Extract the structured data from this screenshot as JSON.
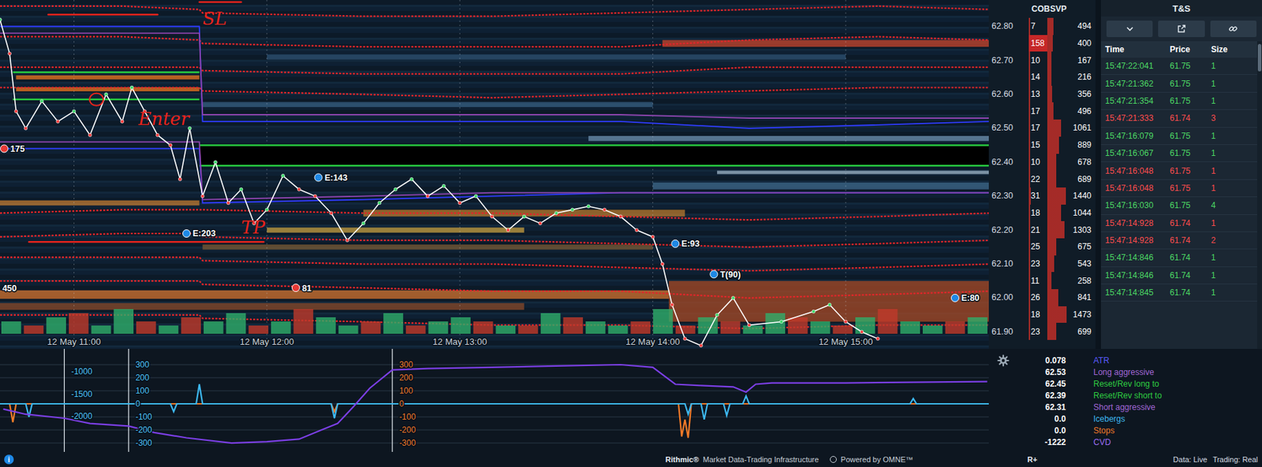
{
  "chart": {
    "x_range": [
      37,
      344.5
    ],
    "y_range": [
      61.85,
      62.878
    ],
    "time_labels": [
      {
        "label": "12 May 11:00",
        "t": 60
      },
      {
        "label": "12 May 12:00",
        "t": 120
      },
      {
        "label": "12 May 13:00",
        "t": 180
      },
      {
        "label": "12 May 14:00",
        "t": 240
      },
      {
        "label": "12 May 15:00",
        "t": 300
      }
    ],
    "heat_bands": [
      {
        "p": 62.01,
        "h": 0.025,
        "t0": 37,
        "t1": 245,
        "color": "#d4722c"
      },
      {
        "p": 61.975,
        "h": 0.02,
        "t0": 37,
        "t1": 200,
        "color": "#8a4a2a"
      },
      {
        "p": 62.25,
        "h": 0.02,
        "t0": 150,
        "t1": 250,
        "color": "#b87a2e"
      },
      {
        "p": 62.2,
        "h": 0.015,
        "t0": 120,
        "t1": 200,
        "color": "#caa040"
      },
      {
        "p": 62.75,
        "h": 0.02,
        "t0": 243,
        "t1": 344.5,
        "color": "#c9452c"
      },
      {
        "p": 61.99,
        "h": 0.12,
        "t0": 245,
        "t1": 344.5,
        "color": "#a84a26"
      },
      {
        "p": 62.47,
        "h": 0.015,
        "t0": 220,
        "t1": 344.5,
        "color": "#6d8fae"
      },
      {
        "p": 62.37,
        "h": 0.01,
        "t0": 260,
        "t1": 344.5,
        "color": "#9fb6c8"
      },
      {
        "p": 62.57,
        "h": 0.015,
        "t0": 100,
        "t1": 240,
        "color": "#355d80"
      },
      {
        "p": 62.33,
        "h": 0.02,
        "t0": 240,
        "t1": 344.5,
        "color": "#3f6a8c"
      },
      {
        "p": 62.15,
        "h": 0.015,
        "t0": 100,
        "t1": 240,
        "color": "#7a5a34"
      },
      {
        "p": 62.71,
        "h": 0.015,
        "t0": 120,
        "t1": 300,
        "color": "#2e5374"
      },
      {
        "p": 62.28,
        "h": 0.015,
        "t0": 37,
        "t1": 99,
        "color": "#c07a30"
      },
      {
        "p": 62.65,
        "h": 0.012,
        "t0": 42,
        "t1": 99,
        "color": "#f07820"
      },
      {
        "p": 62.615,
        "h": 0.012,
        "t0": 42,
        "t1": 99,
        "color": "#f07820"
      }
    ],
    "zones": [
      {
        "kind": "box",
        "t0": 41,
        "t1": 99,
        "top": 62.665,
        "bottom": 62.585,
        "color": "#27c93f"
      },
      {
        "kind": "fill",
        "t0": 99,
        "t1": 344.5,
        "top": 62.45,
        "bottom": 62.39,
        "color": "#27c93f"
      }
    ],
    "lines_t": [
      37,
      75,
      99,
      100,
      150,
      190,
      230,
      270,
      310,
      345
    ],
    "lines": [
      {
        "color": "#e3262a",
        "dashed": true,
        "values": [
          62.86,
          62.86,
          62.85,
          62.84,
          62.83,
          62.83,
          62.84,
          62.85,
          62.86,
          62.85
        ]
      },
      {
        "color": "#e3262a",
        "dashed": true,
        "values": [
          62.77,
          62.77,
          62.76,
          62.75,
          62.74,
          62.74,
          62.74,
          62.76,
          62.77,
          62.76
        ]
      },
      {
        "color": "#e3262a",
        "dashed": true,
        "values": [
          62.68,
          62.68,
          62.68,
          62.67,
          62.66,
          62.66,
          62.66,
          62.68,
          62.68,
          62.68
        ]
      },
      {
        "color": "#e3262a",
        "dashed": true,
        "values": [
          62.62,
          62.62,
          62.62,
          62.61,
          62.6,
          62.59,
          62.6,
          62.61,
          62.62,
          62.62
        ]
      },
      {
        "color": "#2f3cff",
        "dashed": false,
        "values": [
          62.8,
          62.8,
          62.8,
          62.52,
          62.52,
          62.52,
          62.52,
          62.5,
          62.51,
          62.52
        ]
      },
      {
        "color": "#8e44ad",
        "dashed": false,
        "values": [
          62.78,
          62.78,
          62.78,
          62.54,
          62.54,
          62.54,
          62.54,
          62.53,
          62.53,
          62.53
        ]
      },
      {
        "color": "#2f3cff",
        "dashed": false,
        "values": [
          62.44,
          62.44,
          62.44,
          62.28,
          62.29,
          62.3,
          62.31,
          62.31,
          62.31,
          62.31
        ]
      },
      {
        "color": "#8e44ad",
        "dashed": false,
        "values": [
          62.46,
          62.46,
          62.46,
          62.29,
          62.3,
          62.31,
          62.31,
          62.31,
          62.31,
          62.31
        ]
      },
      {
        "color": "#e3262a",
        "dashed": true,
        "values": [
          62.25,
          62.26,
          62.26,
          62.26,
          62.25,
          62.25,
          62.24,
          62.23,
          62.24,
          62.25
        ]
      },
      {
        "color": "#e3262a",
        "dashed": true,
        "values": [
          62.18,
          62.19,
          62.19,
          62.18,
          62.17,
          62.17,
          62.16,
          62.15,
          62.16,
          62.17
        ]
      },
      {
        "color": "#e3262a",
        "dashed": true,
        "values": [
          62.12,
          62.12,
          62.12,
          62.11,
          62.1,
          62.1,
          62.09,
          62.08,
          62.09,
          62.1
        ]
      },
      {
        "color": "#e3262a",
        "dashed": true,
        "values": [
          62.05,
          62.05,
          62.05,
          62.04,
          62.03,
          62.02,
          62.02,
          62.0,
          62.01,
          62.02
        ]
      },
      {
        "color": "#e3262a",
        "dashed": true,
        "values": [
          61.95,
          61.95,
          61.95,
          61.94,
          61.93,
          61.92,
          61.92,
          61.91,
          61.92,
          61.92
        ]
      }
    ],
    "price": {
      "t": [
        37,
        40,
        42,
        45,
        50,
        55,
        60,
        65,
        70,
        75,
        78,
        82,
        86,
        90,
        93,
        96,
        100,
        104,
        108,
        112,
        116,
        120,
        125,
        130,
        135,
        140,
        145,
        150,
        155,
        160,
        165,
        170,
        175,
        180,
        185,
        190,
        195,
        200,
        205,
        210,
        215,
        220,
        225,
        230,
        235,
        240,
        243,
        246,
        250,
        255,
        260,
        265,
        270,
        280,
        290,
        295,
        300,
        305,
        310
      ],
      "p": [
        62.82,
        62.72,
        62.55,
        62.5,
        62.58,
        62.52,
        62.55,
        62.48,
        62.6,
        62.52,
        62.62,
        62.55,
        62.48,
        62.45,
        62.35,
        62.5,
        62.3,
        62.4,
        62.28,
        62.32,
        62.22,
        62.26,
        62.36,
        62.32,
        62.3,
        62.25,
        62.17,
        62.22,
        62.28,
        62.32,
        62.35,
        62.3,
        62.33,
        62.28,
        62.3,
        62.24,
        62.2,
        62.24,
        62.22,
        62.25,
        62.26,
        62.27,
        62.26,
        62.24,
        62.2,
        62.18,
        62.1,
        61.98,
        61.88,
        61.86,
        61.95,
        62.0,
        61.92,
        61.93,
        61.96,
        61.98,
        61.93,
        61.9,
        61.88
      ]
    },
    "volume": [
      3,
      -2,
      4,
      -5,
      2,
      6,
      -3,
      2,
      -4,
      3,
      5,
      -2,
      3,
      -6,
      4,
      2,
      -3,
      5,
      -2,
      3,
      4,
      -3,
      2,
      -2,
      5,
      -4,
      3,
      2,
      -3,
      6,
      -2,
      4,
      -3,
      2,
      5,
      -4,
      3,
      -2,
      4,
      -6,
      3,
      2,
      -3,
      4
    ],
    "markers": [
      {
        "kind": "stop",
        "label": "175",
        "t": 38.3,
        "p": 62.44
      },
      {
        "kind": "entry",
        "label": "E:203",
        "t": 95,
        "p": 62.19
      },
      {
        "kind": "entry",
        "label": "E:143",
        "t": 136,
        "p": 62.355
      },
      {
        "kind": "stop",
        "label": "81",
        "t": 129,
        "p": 62.03
      },
      {
        "kind": "entry",
        "label": "E:93",
        "t": 247,
        "p": 62.16
      },
      {
        "kind": "entry",
        "label": "T(90)",
        "t": 259,
        "p": 62.07
      },
      {
        "kind": "text",
        "label": "450",
        "t": 37.3,
        "p": 62.03
      },
      {
        "kind": "entry",
        "label": "E:80",
        "t": 334,
        "p": 62.0
      }
    ],
    "annotations": [
      {
        "kind": "line",
        "t0": 52,
        "t1": 86,
        "p": 62.835
      },
      {
        "kind": "line",
        "t0": 99,
        "t1": 112,
        "p": 62.872
      },
      {
        "kind": "text",
        "text": "SL",
        "t": 100,
        "p": 62.805
      },
      {
        "kind": "circle",
        "t": 67,
        "p": 62.585
      },
      {
        "kind": "text",
        "text": "Enter",
        "t": 80,
        "p": 62.51
      },
      {
        "kind": "line",
        "t0": 46,
        "t1": 119,
        "p": 62.165
      },
      {
        "kind": "text",
        "text": "TP",
        "t": 112,
        "p": 62.19
      }
    ]
  },
  "ladder": {
    "headers": {
      "cob": "COB",
      "svp": "SVP"
    },
    "rows": [
      {
        "price": "62.80",
        "cob": "7",
        "svp": "494",
        "highlight": false
      },
      {
        "price": "",
        "cob": "158",
        "svp": "400",
        "highlight": true
      },
      {
        "price": "62.70",
        "cob": "10",
        "svp": "167",
        "highlight": false
      },
      {
        "price": "",
        "cob": "14",
        "svp": "216",
        "highlight": false
      },
      {
        "price": "62.60",
        "cob": "13",
        "svp": "356",
        "highlight": false
      },
      {
        "price": "",
        "cob": "17",
        "svp": "496",
        "highlight": false
      },
      {
        "price": "62.50",
        "cob": "17",
        "svp": "1061",
        "highlight": false
      },
      {
        "price": "",
        "cob": "15",
        "svp": "889",
        "highlight": false
      },
      {
        "price": "62.40",
        "cob": "10",
        "svp": "678",
        "highlight": false
      },
      {
        "price": "",
        "cob": "22",
        "svp": "689",
        "highlight": false
      },
      {
        "price": "62.30",
        "cob": "31",
        "svp": "1440",
        "highlight": false
      },
      {
        "price": "",
        "cob": "18",
        "svp": "1044",
        "highlight": false
      },
      {
        "price": "62.20",
        "cob": "21",
        "svp": "1303",
        "highlight": false
      },
      {
        "price": "",
        "cob": "25",
        "svp": "675",
        "highlight": false
      },
      {
        "price": "62.10",
        "cob": "23",
        "svp": "543",
        "highlight": false
      },
      {
        "price": "",
        "cob": "11",
        "svp": "258",
        "highlight": false
      },
      {
        "price": "62.00",
        "cob": "26",
        "svp": "841",
        "highlight": false
      },
      {
        "price": "",
        "cob": "18",
        "svp": "1473",
        "highlight": false
      },
      {
        "price": "61.90",
        "cob": "23",
        "svp": "699",
        "highlight": false
      }
    ]
  },
  "time_sales": {
    "title": "T&S",
    "columns": [
      "Time",
      "Price",
      "Size"
    ],
    "rows": [
      {
        "time": "15:47:22:041",
        "price": "61.75",
        "size": "1",
        "color": "#4cd964"
      },
      {
        "time": "15:47:21:362",
        "price": "61.75",
        "size": "1",
        "color": "#4cd964"
      },
      {
        "time": "15:47:21:354",
        "price": "61.75",
        "size": "1",
        "color": "#4cd964"
      },
      {
        "time": "15:47:21:333",
        "price": "61.74",
        "size": "3",
        "color": "#ff4d4d"
      },
      {
        "time": "15:47:16:079",
        "price": "61.75",
        "size": "1",
        "color": "#4cd964"
      },
      {
        "time": "15:47:16:067",
        "price": "61.75",
        "size": "1",
        "color": "#4cd964"
      },
      {
        "time": "15:47:16:048",
        "price": "61.75",
        "size": "1",
        "color": "#ff4d4d"
      },
      {
        "time": "15:47:16:048",
        "price": "61.75",
        "size": "1",
        "color": "#ff4d4d"
      },
      {
        "time": "15:47:16:030",
        "price": "61.75",
        "size": "4",
        "color": "#4cd964"
      },
      {
        "time": "15:47:14:928",
        "price": "61.74",
        "size": "1",
        "color": "#ff4d4d"
      },
      {
        "time": "15:47:14:928",
        "price": "61.74",
        "size": "2",
        "color": "#ff4d4d"
      },
      {
        "time": "15:47:14:846",
        "price": "61.74",
        "size": "1",
        "color": "#4cd964"
      },
      {
        "time": "15:47:14:846",
        "price": "61.74",
        "size": "1",
        "color": "#4cd964"
      },
      {
        "time": "15:47:14:845",
        "price": "61.74",
        "size": "1",
        "color": "#4cd964"
      }
    ]
  },
  "indicator": {
    "scales": [
      {
        "t": 57,
        "color": "#4fc3f7",
        "min": -2800,
        "max": -492,
        "ticks": [
          "-1000",
          "-1500",
          "-2000"
        ]
      },
      {
        "t": 77,
        "color": "#4fc3f7",
        "min": -368,
        "max": 421,
        "ticks": [
          "300",
          "200",
          "100",
          "0",
          "-100",
          "-200",
          "-300"
        ]
      },
      {
        "t": 159,
        "color": "#f07a28",
        "min": -368,
        "max": 421,
        "ticks": [
          "300",
          "200",
          "100",
          "0",
          "-100",
          "-200",
          "-300"
        ]
      }
    ],
    "series": [
      {
        "color": "#f07a28",
        "t": [
          37,
          40,
          41,
          42,
          60,
          140,
          141,
          142,
          248,
          249,
          250,
          251,
          252,
          345
        ],
        "v": [
          0,
          0,
          -140,
          0,
          0,
          0,
          -60,
          0,
          0,
          -250,
          -120,
          -260,
          0,
          0
        ]
      },
      {
        "color": "#3db8f0",
        "t": [
          37,
          45,
          46,
          47,
          90,
          91,
          92,
          98,
          99,
          100,
          140,
          141,
          142,
          250,
          251,
          252,
          255,
          256,
          257,
          262,
          263,
          264,
          268,
          269,
          270,
          320,
          321,
          322,
          345
        ],
        "v": [
          0,
          0,
          -100,
          0,
          0,
          -60,
          0,
          0,
          150,
          0,
          0,
          -110,
          0,
          0,
          -80,
          0,
          0,
          -120,
          0,
          0,
          -90,
          0,
          0,
          60,
          0,
          0,
          40,
          0,
          0
        ]
      },
      {
        "color": "#7b3fe4",
        "t": [
          38,
          45,
          57,
          65,
          77,
          85,
          95,
          109,
          120,
          130,
          137,
          142,
          147,
          152,
          159,
          170,
          190,
          210,
          230,
          240,
          247,
          255,
          265,
          269,
          272,
          277,
          300,
          320,
          344
        ],
        "v": [
          -40,
          -80,
          -110,
          -150,
          -170,
          -220,
          -260,
          -300,
          -290,
          -270,
          -200,
          -150,
          -20,
          120,
          260,
          270,
          280,
          290,
          300,
          280,
          150,
          140,
          130,
          90,
          150,
          160,
          160,
          165,
          170
        ]
      }
    ]
  },
  "legend": [
    {
      "value": "0.078",
      "label": "ATR",
      "color": "#5a5aff"
    },
    {
      "value": "62.53",
      "label": "Long aggressive",
      "color": "#a066d6"
    },
    {
      "value": "62.45",
      "label": "Reset/Rev long to",
      "color": "#2ecc40"
    },
    {
      "value": "62.39",
      "label": "Reset/Rev short to",
      "color": "#2ecc40"
    },
    {
      "value": "62.31",
      "label": "Short aggressive",
      "color": "#a066d6"
    },
    {
      "value": "0.0",
      "label": "Icebergs",
      "color": "#3db8f0"
    },
    {
      "value": "0.0",
      "label": "Stops",
      "color": "#f07a28"
    },
    {
      "value": "-1222",
      "label": "CVD",
      "color": "#9a6cf0"
    }
  ],
  "footer": {
    "info": "i",
    "provider": "Rithmic®",
    "tagline": "Market Data-Trading Infrastructure",
    "powered": "Powered by OMNE™",
    "badge": "R+",
    "data_status": "Data: Live",
    "trading_status": "Trading: Real"
  }
}
